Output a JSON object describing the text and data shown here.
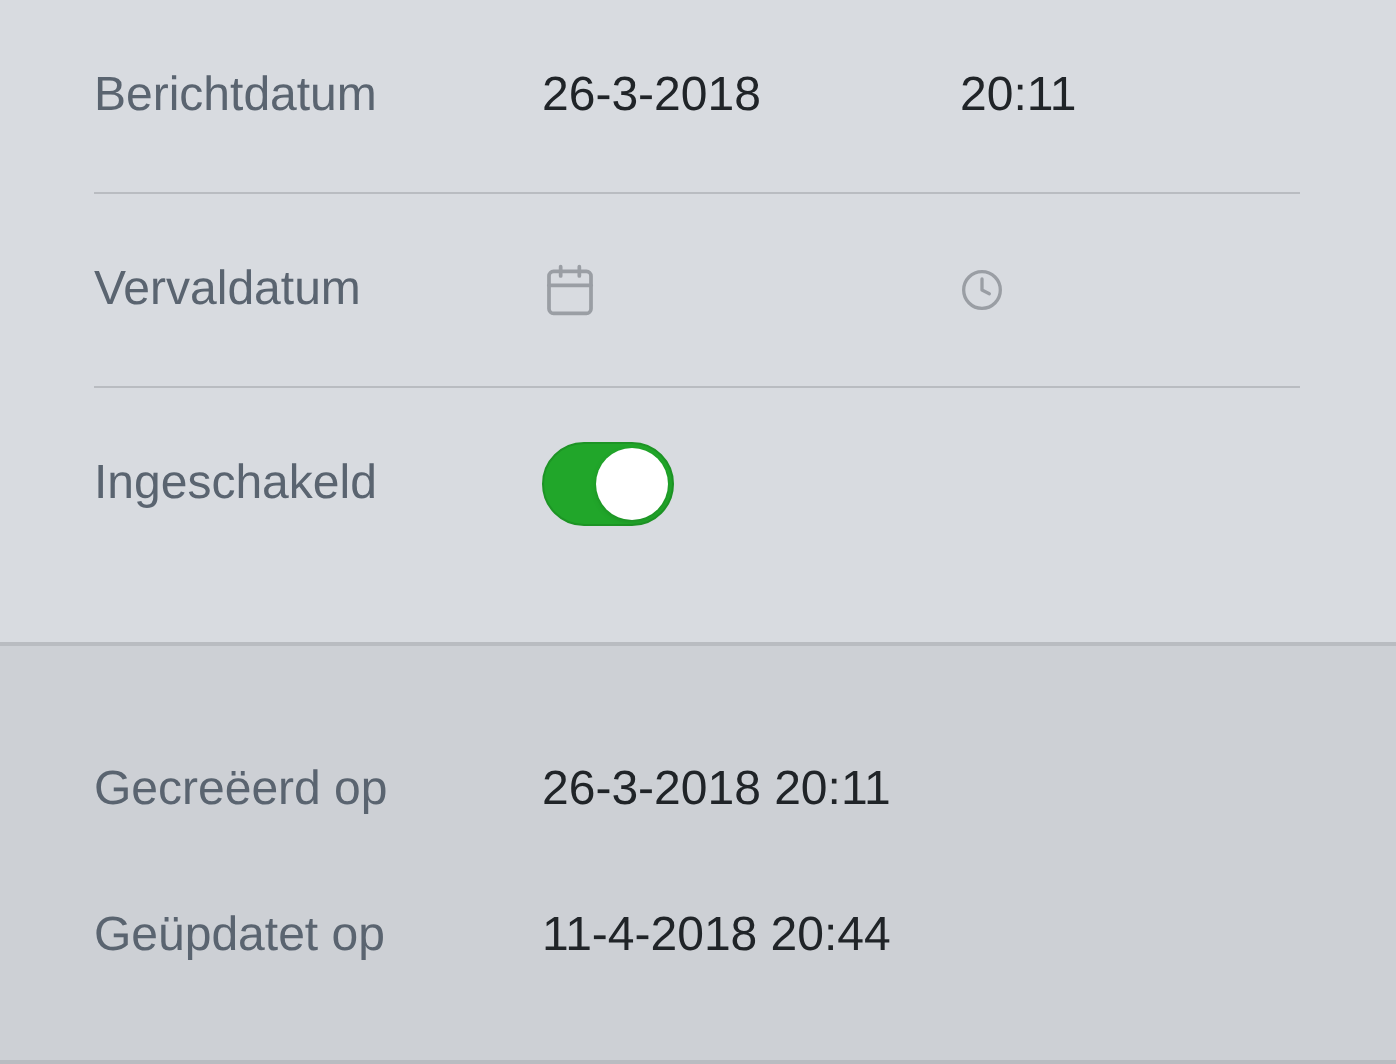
{
  "fields": [
    {
      "label": "Berichtdatum",
      "date": "26-3-2018",
      "time": "20:11"
    },
    {
      "label": "Vervaldatum"
    }
  ],
  "toggle": {
    "label": "Ingeschakeld",
    "on": true
  },
  "meta": [
    {
      "label": "Gecreëerd op",
      "value": "26-3-2018 20:11"
    },
    {
      "label": "Geüpdatet op",
      "value": "11-4-2018 20:44"
    }
  ]
}
